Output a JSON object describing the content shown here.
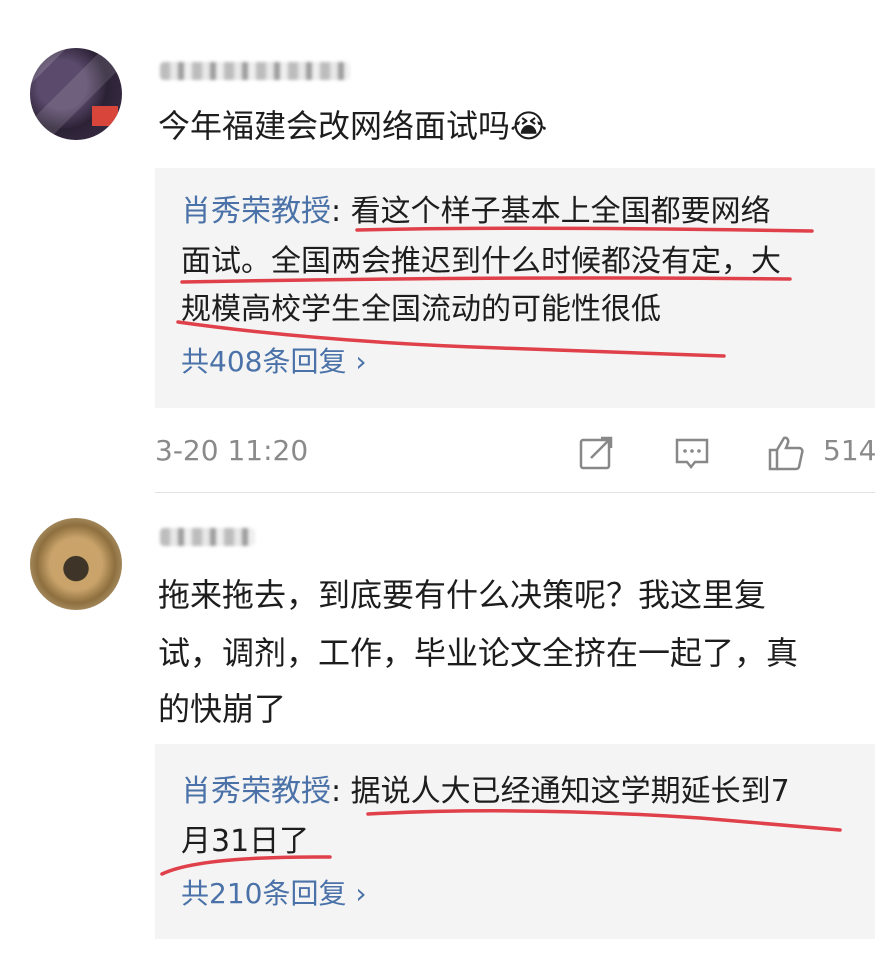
{
  "comments": [
    {
      "text": "今年福建会改网络面试吗😭",
      "reply": {
        "author": "肖秀荣教授",
        "sep": ": ",
        "line1": "看这个样子基本上全国都要网络",
        "line2": "面试。全国两会推迟到什么时候都没有定，大",
        "line3": "规模高校学生全国流动的可能性很低",
        "count_label": "共408条回复 ›"
      },
      "time": "3-20 11:20",
      "likes": "514",
      "icons": [
        "share-icon",
        "comment-icon",
        "thumbs-up-icon"
      ]
    },
    {
      "line1": "拖来拖去，到底要有什么决策呢？我这里复",
      "line2": "试，调剂，工作，毕业论文全挤在一起了，真",
      "line3": "的快崩了",
      "reply": {
        "author": "肖秀荣教授",
        "sep": ": ",
        "line1": "据说人大已经通知这学期延长到7",
        "line2": "月31日了",
        "count_label": "共210条回复 ›"
      }
    }
  ],
  "colors": {
    "link": "#4a72a8",
    "underline": "#e0404a",
    "reply_bg": "#f4f4f4"
  }
}
